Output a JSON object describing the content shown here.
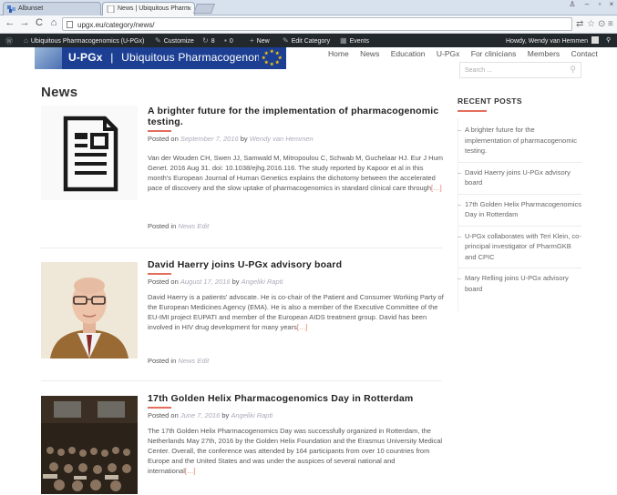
{
  "browser": {
    "tabs": [
      {
        "label": "Albunset",
        "active": false
      },
      {
        "label": "News | Ubiquitous Pharm",
        "active": true
      }
    ],
    "url": "upgx.eu/category/news/"
  },
  "adminbar": {
    "site": "Ubiquitous Pharmacogenomics (U-PGx)",
    "customize": "Customize",
    "updates": "8",
    "comments": "0",
    "new": "New",
    "edit_category": "Edit Category",
    "events": "Events",
    "howdy": "Howdy, Wendy van Hemmen"
  },
  "header": {
    "logo_main": "U-PGx",
    "logo_sep": "|",
    "logo_tagline": "Ubiquitous  Pharmacogenomics",
    "nav": [
      "Home",
      "News",
      "Education",
      "U-PGx",
      "For clinicians",
      "Members",
      "Contact"
    ],
    "search_placeholder": "Search ..."
  },
  "page_title": "News",
  "posts": [
    {
      "title": "A brighter future for the implementation of pharmacogenomic testing.",
      "posted_on_label": "Posted on",
      "date": "September 7, 2016",
      "by": "by",
      "author": "Wendy van Hemmen",
      "excerpt": "Van der Wouden CH, Swen JJ, Samwald M, Mitropoulou C, Schwab M, Guchelaar HJ. Eur J Hum Genet. 2016 Aug 31. doi: 10.1038/ejhg.2016.116. The study reported by Kapoor et al in this month's European Journal of Human Genetics explains the dichotomy between the accelerated pace of discovery and the slow uptake of pharmacogenomics in standard clinical care through",
      "more": "[…]",
      "posted_in_label": "Posted in",
      "category": "News",
      "edit": "Edit"
    },
    {
      "title": "David Haerry joins U-PGx advisory board",
      "posted_on_label": "Posted on",
      "date": "August 17, 2016",
      "by": "by",
      "author": "Angeliki Rapti",
      "excerpt": "David Haerry is a patients' advocate. He is co-chair of the Patient and Consumer Working Party of the European Medicines Agency (EMA). He is also a member of the Executive Committee of the EU-IMI project EUPATI and member of the European AIDS treatment group. David has been involved in HIV drug development for many years",
      "more": "[…]",
      "posted_in_label": "Posted in",
      "category": "News",
      "edit": "Edit"
    },
    {
      "title": "17th Golden Helix Pharmacogenomics Day in Rotterdam",
      "posted_on_label": "Posted on",
      "date": "June 7, 2016",
      "by": "by",
      "author": "Angeliki Rapti",
      "excerpt": "The 17th Golden Helix Pharmacogenomics Day was successfully organized in Rotterdam, the Netherlands May 27th, 2016 by the Golden Helix Foundation and the Erasmus University Medical Center. Overall, the conference was attended by 164 participants from over 10 countries from Europe and the United States and was under the auspices of several national and international",
      "more": "[…]"
    }
  ],
  "sidebar": {
    "heading": "RECENT POSTS",
    "items": [
      "A brighter future for the implementation of pharmacogenomic testing.",
      "David Haerry joins U-PGx advisory board",
      "17th Golden Helix Pharmacogenomics Day in Rotterdam",
      "U-PGx collaborates with Teri Klein, co-principal investigator of PharmGKB and CPIC",
      "Mary Relling joins U-PGx advisory board"
    ]
  },
  "colors": {
    "accent": "#e26e5c",
    "logo_blue": "#1c3f93",
    "adminbar": "#23282d"
  }
}
